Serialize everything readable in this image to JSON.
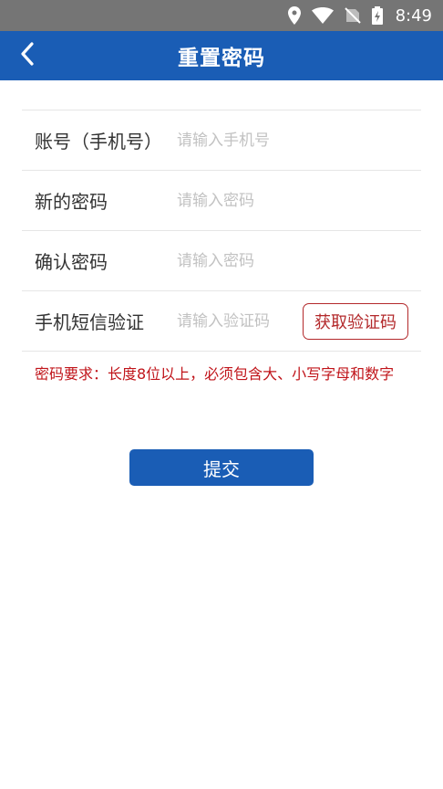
{
  "status_bar": {
    "time": "8:49",
    "icons": [
      "location-icon",
      "wifi-icon",
      "no-sim-icon",
      "battery-charging-icon"
    ]
  },
  "app_bar": {
    "title": "重置密码",
    "back_icon": "chevron-left-icon"
  },
  "form": {
    "account": {
      "label": "账号（手机号）",
      "placeholder": "请输入手机号",
      "value": ""
    },
    "new_password": {
      "label": "新的密码",
      "placeholder": "请输入密码",
      "value": ""
    },
    "confirm_password": {
      "label": "确认密码",
      "placeholder": "请输入密码",
      "value": ""
    },
    "sms_code": {
      "label": "手机短信验证",
      "placeholder": "请输入验证码",
      "value": "",
      "button_label": "获取验证码"
    }
  },
  "requirement_text": "密码要求：长度8位以上，必须包含大、小写字母和数字",
  "submit_label": "提交",
  "colors": {
    "primary": "#1a5db5",
    "status_bar": "#757575",
    "error_red": "#c0141a",
    "button_border_red": "#b3292b"
  }
}
